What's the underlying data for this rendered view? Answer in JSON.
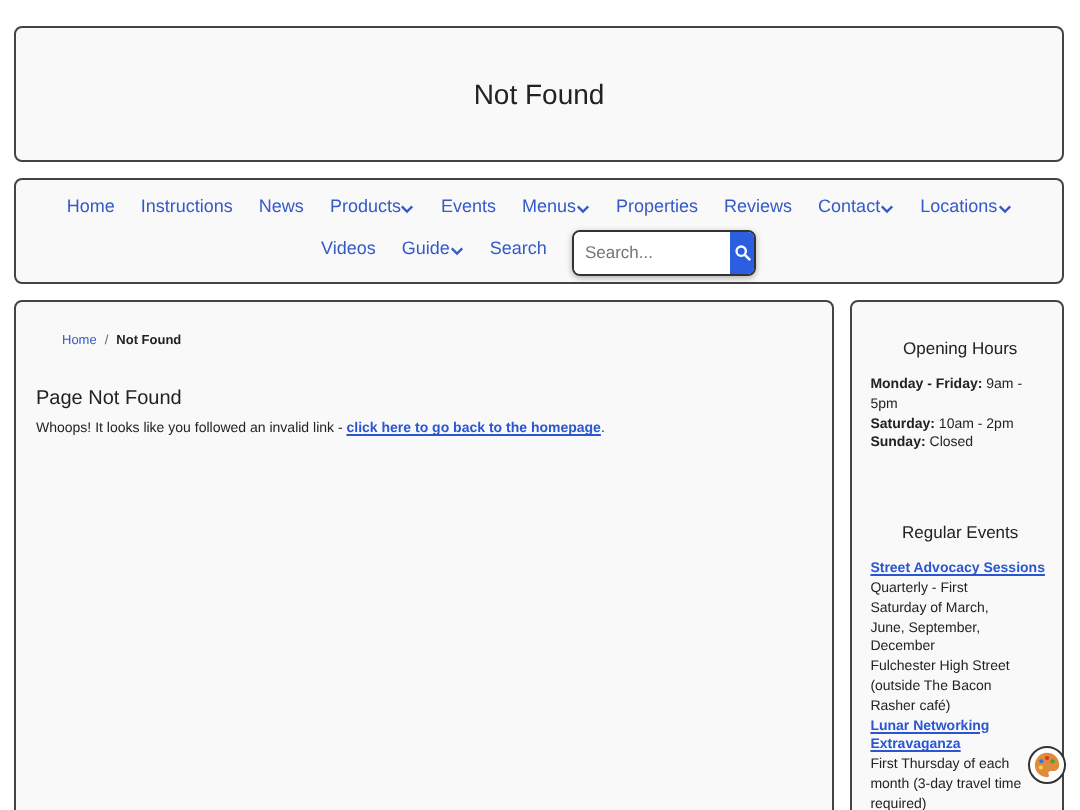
{
  "header": {
    "title": "Not Found"
  },
  "nav": {
    "items": [
      {
        "label": "Home",
        "dropdown": false
      },
      {
        "label": "Instructions",
        "dropdown": false
      },
      {
        "label": "News",
        "dropdown": false
      },
      {
        "label": "Products",
        "dropdown": true
      },
      {
        "label": "Events",
        "dropdown": false
      },
      {
        "label": "Menus",
        "dropdown": true
      },
      {
        "label": "Properties",
        "dropdown": false
      },
      {
        "label": "Reviews",
        "dropdown": false
      },
      {
        "label": "Contact",
        "dropdown": true
      },
      {
        "label": "Locations",
        "dropdown": true
      },
      {
        "label": "Videos",
        "dropdown": false
      },
      {
        "label": "Guide",
        "dropdown": true
      },
      {
        "label": "Search",
        "dropdown": false
      }
    ],
    "search": {
      "placeholder": "Search..."
    }
  },
  "breadcrumb_separator": "/",
  "breadcrumb": [
    {
      "label": "Home",
      "current": false
    },
    {
      "label": "Not Found",
      "current": true
    }
  ],
  "main": {
    "heading": "Page Not Found",
    "message": "Whoops! It looks like you followed an invalid link - ",
    "link": "click here to go back to the homepage",
    "message_end": "."
  },
  "sidebar": {
    "hours": {
      "title": "Opening Hours",
      "rows": [
        {
          "day": "Monday - Friday:",
          "time": "9am - 5pm"
        },
        {
          "day": "Saturday:",
          "time": "10am - 2pm"
        },
        {
          "day": "Sunday:",
          "time": "Closed"
        }
      ]
    },
    "events": {
      "title": "Regular Events",
      "items": [
        {
          "name": "Street Advocacy Sessions",
          "lines": [
            "Quarterly - First Saturday of March, June, September, December",
            "Fulchester High Street (outside The Bacon Rasher café)"
          ]
        },
        {
          "name": "Lunar Networking Extravaganza",
          "lines": [
            "First Thursday of each month (3-day travel time required)"
          ]
        }
      ]
    }
  }
}
